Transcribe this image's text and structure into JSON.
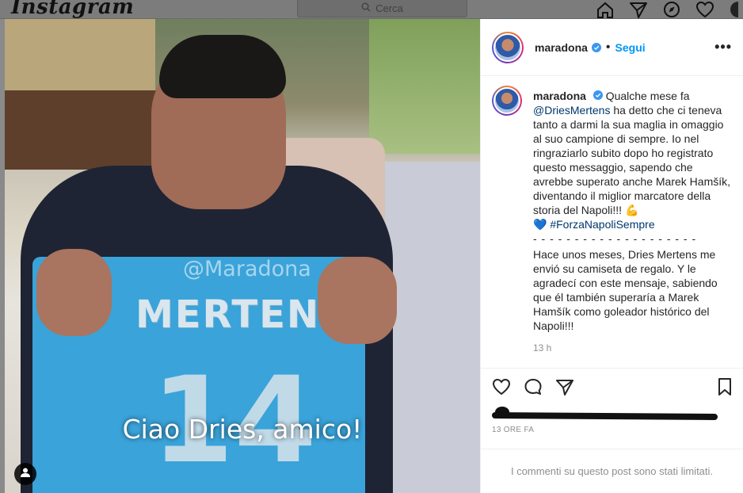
{
  "nav": {
    "logo": "Instagram",
    "search_placeholder": "Cerca"
  },
  "post": {
    "username": "maradona",
    "follow_label": "Segui",
    "more_label": "•••",
    "caption_user": "maradona",
    "caption_intro": "Qualche mese fa",
    "caption_mention": "@DriesMertens",
    "caption_it_rest": "ha detto che ci teneva tanto a darmi la sua maglia in omaggio al suo campione di sempre. Io nel ringraziarlo subito dopo ho registrato questo messaggio, sapendo che avrebbe superato anche Marek Hamšík, diventando il miglior marcatore della storia del Napoli!!! 💪",
    "caption_heart": "💙",
    "caption_hashtag": "#ForzaNapoliSempre",
    "caption_separator": "- - - - - - - - - - - - - - - - - - - -",
    "caption_es": "Hace unos meses, Dries Mertens me envió su camiseta de regalo. Y le agradecí con este mensaje, sabiendo que él también superaría a Marek Hamšík como goleador histórico del Napoli!!!",
    "caption_time": "13 h",
    "post_time": "13 ORE FA",
    "comments_limited": "I commenti su questo post sono stati limitati."
  },
  "video": {
    "subtitle": "Ciao Dries, amico!",
    "watermark": "@Maradona",
    "shirt_name": "MERTENS",
    "shirt_number": "14"
  },
  "colors": {
    "accent": "#0095f6",
    "mention": "#00376b",
    "muted": "#8e8e8e"
  }
}
